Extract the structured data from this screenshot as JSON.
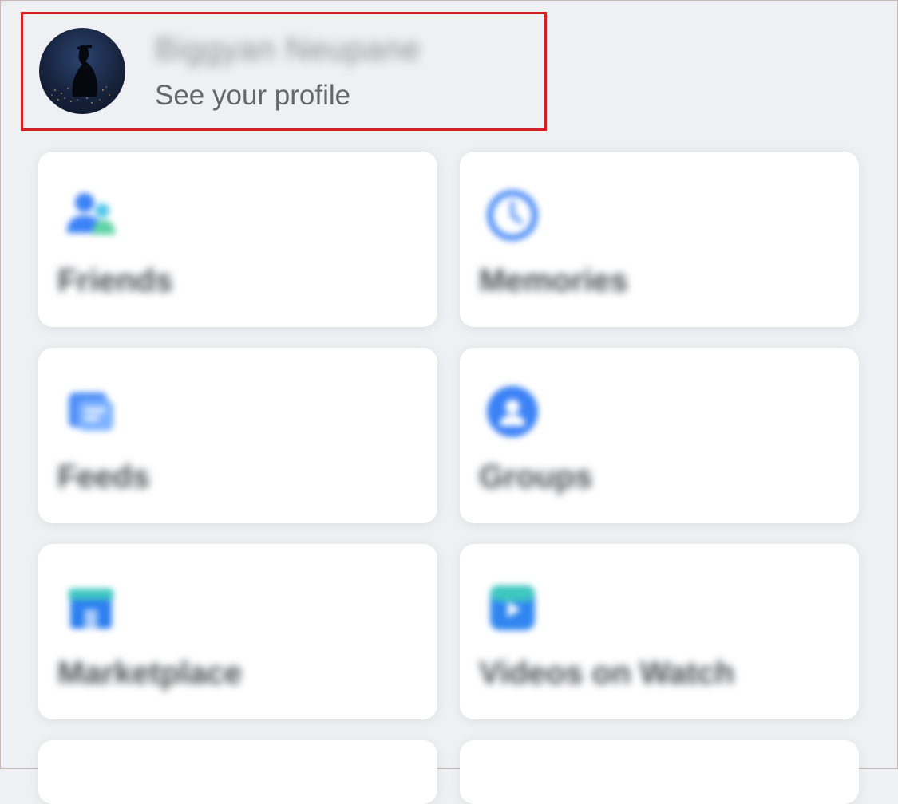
{
  "profile": {
    "name": "Biggyan Neupane",
    "subtitle": "See your profile"
  },
  "shortcuts": [
    {
      "label": "Friends",
      "icon": "friends-icon"
    },
    {
      "label": "Memories",
      "icon": "memories-icon"
    },
    {
      "label": "Feeds",
      "icon": "feeds-icon"
    },
    {
      "label": "Groups",
      "icon": "groups-icon"
    },
    {
      "label": "Marketplace",
      "icon": "marketplace-icon"
    },
    {
      "label": "Videos on Watch",
      "icon": "videos-on-watch-icon"
    }
  ],
  "colors": {
    "highlight_border": "#d42020",
    "background": "#eef0f3",
    "subtitle": "#65676b"
  }
}
